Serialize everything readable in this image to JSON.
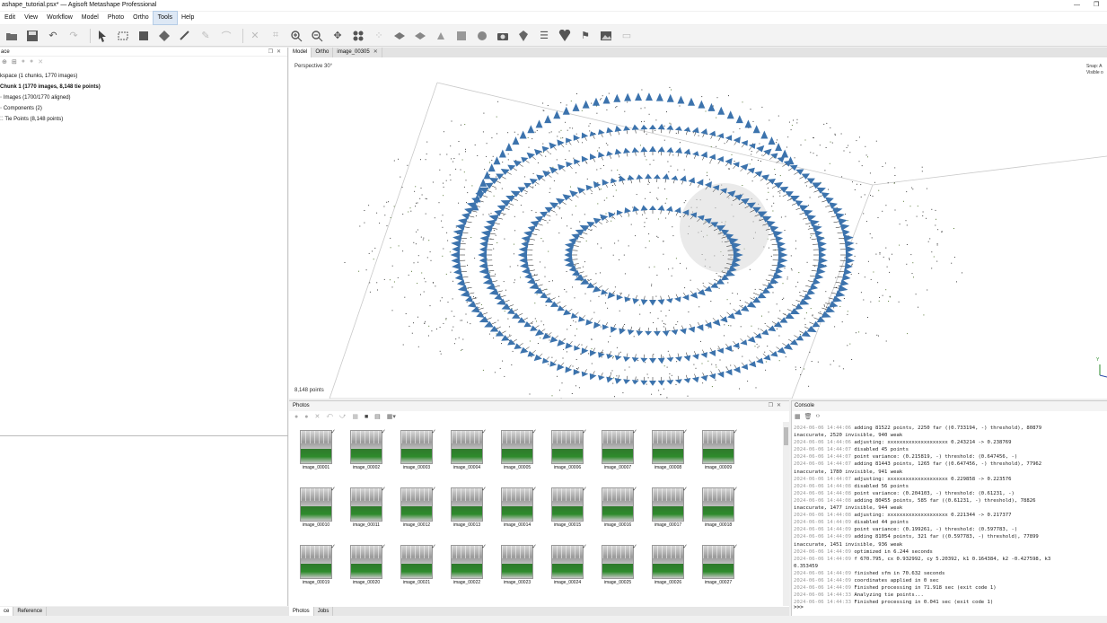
{
  "window": {
    "title": "ashape_tutorial.psx* — Agisoft Metashape Professional",
    "minimize_glyph": "—",
    "maximize_glyph": "❐"
  },
  "menu": [
    "Edit",
    "View",
    "Workflow",
    "Model",
    "Photo",
    "Ortho",
    "Tools",
    "Help"
  ],
  "workspace": {
    "panel_title": "ace",
    "root": "kspace (1 chunks, 1770 images)",
    "chunk": "Chunk 1 (1770 images, 8,148 tie points)",
    "images": "Images (1700/1770 aligned)",
    "components": "Components (2)",
    "tie_points": "Tie Points (8,148 points)"
  },
  "bottom_left_tabs": [
    "ce",
    "Reference"
  ],
  "model_tabs": [
    "Model",
    "Ortho",
    "image_00305"
  ],
  "viewport": {
    "projection": "Perspective 30°",
    "point_count": "8,148 points",
    "snap_line1": "Snap: A",
    "snap_line2": "Visible o",
    "axis_label": "Y"
  },
  "photos": {
    "panel_title": "Photos",
    "items": [
      "image_00001",
      "image_00002",
      "image_00003",
      "image_00004",
      "image_00005",
      "image_00006",
      "image_00007",
      "image_00008",
      "image_00009",
      "image_00010",
      "image_00011",
      "image_00012",
      "image_00013",
      "image_00014",
      "image_00015",
      "image_00016",
      "image_00017",
      "image_00018",
      "image_00019",
      "image_00020",
      "image_00021",
      "image_00022",
      "image_00023",
      "image_00024",
      "image_00025",
      "image_00026",
      "image_00027"
    ]
  },
  "bottom_mid_tabs": [
    "Photos",
    "Jobs"
  ],
  "console": {
    "panel_title": "Console",
    "lines": [
      [
        "2024-06-06 14:44:06",
        " adding 81522 points, 2250 far ((0.733194, -) threshold), 80879"
      ],
      [
        "",
        "inaccurate, 2520 invisible, 940 weak"
      ],
      [
        "2024-06-06 14:44:06",
        " adjusting: xxxxxxxxxxxxxxxxxxxx 0.243214 -> 0.238769"
      ],
      [
        "2024-06-06 14:44:07",
        " disabled 45 points"
      ],
      [
        "2024-06-06 14:44:07",
        " point variance: (0.215819, -) threshold: (0.647456, -)"
      ],
      [
        "2024-06-06 14:44:07",
        " adding 81443 points, 1265 far ((0.647456, -) threshold), 77962"
      ],
      [
        "",
        "inaccurate, 1780 invisible, 941 weak"
      ],
      [
        "2024-06-06 14:44:07",
        " adjusting: xxxxxxxxxxxxxxxxxxxx 0.229858 -> 0.223576"
      ],
      [
        "2024-06-06 14:44:08",
        " disabled 56 points"
      ],
      [
        "2024-06-06 14:44:08",
        " point variance: (0.204103, -) threshold: (0.61231, -)"
      ],
      [
        "2024-06-06 14:44:08",
        " adding 80455 points, 585 far ((0.61231, -) threshold), 78826"
      ],
      [
        "",
        "inaccurate, 1477 invisible, 944 weak"
      ],
      [
        "2024-06-06 14:44:08",
        " adjusting: xxxxxxxxxxxxxxxxxxxx 0.221344 -> 0.217377"
      ],
      [
        "2024-06-06 14:44:09",
        " disabled 44 points"
      ],
      [
        "2024-06-06 14:44:09",
        " point variance: (0.199261, -) threshold: (0.597783, -)"
      ],
      [
        "2024-06-06 14:44:09",
        " adding 81054 points, 321 far ((0.597783, -) threshold), 77899"
      ],
      [
        "",
        "inaccurate, 1451 invisible, 936 weak"
      ],
      [
        "2024-06-06 14:44:09",
        " optimized in 6.244 seconds"
      ],
      [
        "2024-06-06 14:44:09",
        " f 670.795, cx 0.932992, cy 5.20392, k1 0.164384, k2 -0.427598, k3"
      ],
      [
        "",
        "0.353459"
      ],
      [
        "2024-06-06 14:44:09",
        " finished sfm in 70.632 seconds"
      ],
      [
        "2024-06-06 14:44:09",
        " coordinates applied in 0 sec"
      ],
      [
        "2024-06-06 14:44:09",
        " Finished processing in 71.918 sec (exit code 1)"
      ],
      [
        "2024-06-06 14:44:33",
        " Analyzing tie points..."
      ],
      [
        "2024-06-06 14:44:33",
        " Finished processing in 0.041 sec (exit code 1)"
      ]
    ],
    "prompt": ">>>"
  },
  "colors": {
    "camera_blue": "#3c73ad",
    "accent_menu": "#dde8f5"
  }
}
